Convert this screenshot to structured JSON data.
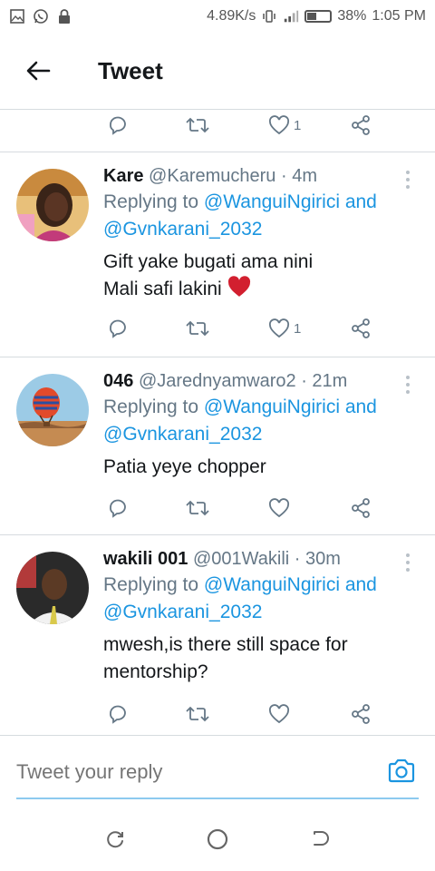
{
  "status_bar": {
    "network_speed": "4.89K/s",
    "battery_percent": "38%",
    "battery_level": 0.38,
    "time": "1:05 PM",
    "icons": [
      "gallery-icon",
      "whatsapp-icon",
      "lock-icon",
      "vibrate-icon",
      "signal-icon",
      "battery-icon"
    ]
  },
  "header": {
    "title": "Tweet",
    "back_icon": "arrow-left-icon"
  },
  "top_actions": {
    "like_count": "1"
  },
  "tweets": [
    {
      "name": "Kare",
      "handle": "@Karemucheru",
      "time": "· 4m",
      "replying_prefix": "Replying to ",
      "replying_link1": "@WanguiNgirici and",
      "replying_link2": "@Gvnkarani_2032",
      "text_line1": "Gift yake bugati ama nini",
      "text_line2": "Mali safi lakini",
      "emoji": "❤️",
      "like_count": "1"
    },
    {
      "name": "046",
      "handle": "@Jarednyamwaro2",
      "time": "· 21m",
      "replying_prefix": "Replying to ",
      "replying_link1": "@WanguiNgirici and",
      "replying_link2": "@Gvnkarani_2032",
      "text_line1": "Patia yeye chopper",
      "like_count": ""
    },
    {
      "name": "wakili 001",
      "handle": "@001Wakili",
      "time": "· 30m",
      "replying_prefix": "Replying to ",
      "replying_link1": "@WanguiNgirici and",
      "replying_link2": "@Gvnkarani_2032",
      "text_line1": "mwesh,is there still space for",
      "text_line2": "mentorship?",
      "like_count": ""
    }
  ],
  "reply_bar": {
    "placeholder": "Tweet your reply"
  },
  "colors": {
    "accent": "#1b95e0",
    "secondary_text": "#657786",
    "divider": "#d6dbdf",
    "heart_red": "#e0245e"
  }
}
